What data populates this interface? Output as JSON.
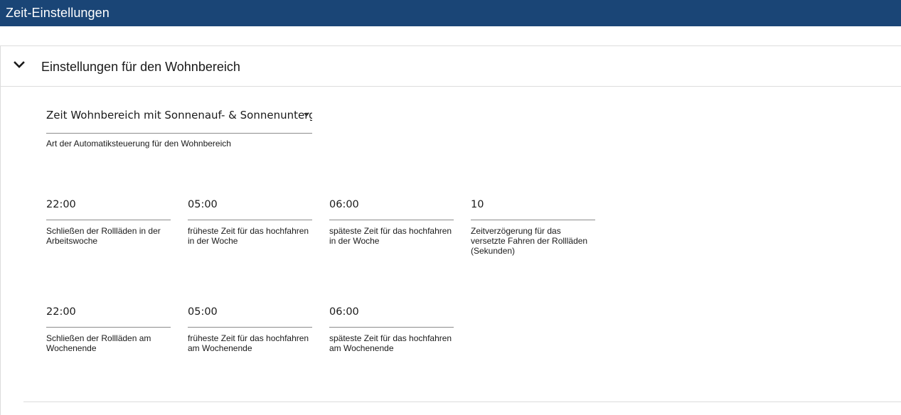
{
  "window": {
    "title": "Zeit-Einstellungen"
  },
  "panel": {
    "title": "Einstellungen für den Wohnbereich",
    "chevron_icon": "chevron-down-icon",
    "mode_select": {
      "value": "Zeit Wohnbereich mit Sonnenauf- & Sonnenuntergang",
      "help": "Art der Automatiksteuerung für den Wohnbereich"
    },
    "week_fields": [
      {
        "value": "22:00",
        "label": "Schließen der Rollläden in der Arbeitswoche"
      },
      {
        "value": "05:00",
        "label": "früheste Zeit für das hochfahren in der Woche"
      },
      {
        "value": "06:00",
        "label": "späteste Zeit für das hochfahren in der Woche"
      },
      {
        "value": "10",
        "label": "Zeitverzögerung für das versetzte Fahren der Rollläden (Sekunden)"
      }
    ],
    "weekend_fields": [
      {
        "value": "22:00",
        "label": "Schließen der Rollläden am Wochenende"
      },
      {
        "value": "05:00",
        "label": "früheste Zeit für das hochfahren am Wochenende"
      },
      {
        "value": "06:00",
        "label": "späteste Zeit für das hochfahren am Wochenende"
      }
    ]
  },
  "colors": {
    "titlebar_bg": "#1a4576",
    "titlebar_text": "#ffffff",
    "underline": "#8c8c8c",
    "divider": "#dcdcdc"
  }
}
